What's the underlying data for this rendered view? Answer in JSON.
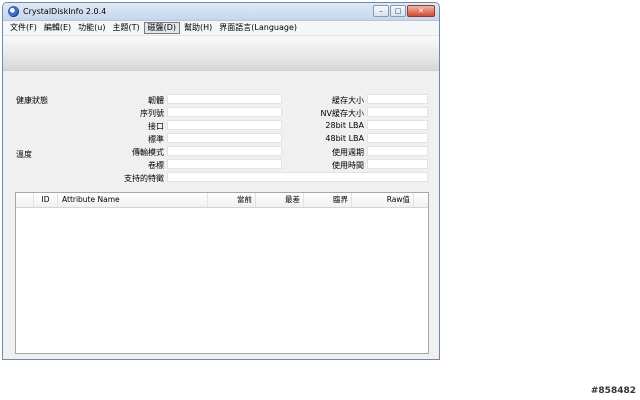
{
  "window": {
    "title": "CrystalDiskInfo 2.0.4",
    "caption_minimize": "–",
    "caption_maximize": "□",
    "caption_close": "✕"
  },
  "menu": [
    {
      "label": "文件(F)"
    },
    {
      "label": "編輯(E)"
    },
    {
      "label": "功能(u)"
    },
    {
      "label": "主題(T)"
    },
    {
      "label": "磁盤(D)",
      "active": true
    },
    {
      "label": "幫助(H)"
    },
    {
      "label": "界面語言(Language)"
    }
  ],
  "info": {
    "health_label": "健康狀態",
    "temperature_label": "溫度",
    "firmware_label": "韌體",
    "serial_label": "序列號",
    "interface_label": "接口",
    "standard_label": "標準",
    "transfer_mode_label": "傳輸模式",
    "volume_label": "卷標",
    "features_label": "支持的特徵",
    "cache_label": "緩存大小",
    "nv_cache_label": "NV緩存大小",
    "lba28_label": "28bit LBA",
    "lba48_label": "48bit LBA",
    "power_on_count_label": "使用週期",
    "power_on_hours_label": "使用時間"
  },
  "table": {
    "col_id": "ID",
    "col_attr": "Attribute Name",
    "col_current": "當前",
    "col_worst": "最差",
    "col_threshold": "臨界",
    "col_raw": "Raw值"
  },
  "watermark": "#858482"
}
